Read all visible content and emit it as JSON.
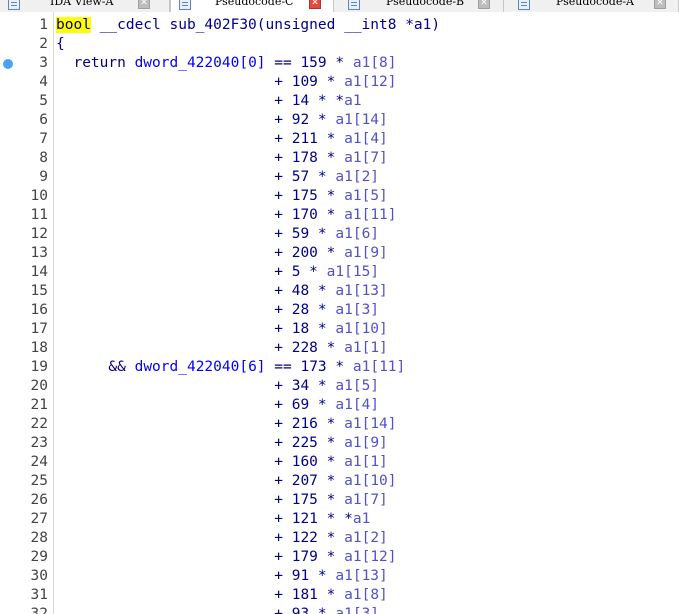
{
  "tabs": [
    {
      "label": "IDA View-A",
      "icon": "document-icon",
      "close_style": "grey",
      "active": false
    },
    {
      "label": "Pseudocode-C",
      "icon": "document-icon",
      "close_style": "red",
      "active": true
    },
    {
      "label": "Pseudocode-B",
      "icon": "document-icon",
      "close_style": "grey",
      "active": false
    },
    {
      "label": "Pseudocode-A",
      "icon": "document-icon",
      "close_style": "grey",
      "active": false
    }
  ],
  "close_glyph": "✕",
  "code": {
    "signature": {
      "ret_type": "bool",
      "rest": " __cdecl sub_402F30(unsigned __int8 *a1)"
    },
    "brace": "{",
    "return_kw": "return ",
    "and_op": "&& ",
    "eq": " == ",
    "plus": "+ ",
    "blocks": [
      {
        "dword": "dword_422040[0]",
        "terms": [
          {
            "c": "159",
            "a": "a1[8]"
          },
          {
            "c": "109",
            "a": "a1[12]"
          },
          {
            "c": "14",
            "a": "a1",
            "deref": true
          },
          {
            "c": "92",
            "a": "a1[14]"
          },
          {
            "c": "211",
            "a": "a1[4]"
          },
          {
            "c": "178",
            "a": "a1[7]"
          },
          {
            "c": "57",
            "a": "a1[2]"
          },
          {
            "c": "175",
            "a": "a1[5]"
          },
          {
            "c": "170",
            "a": "a1[11]"
          },
          {
            "c": "59",
            "a": "a1[6]"
          },
          {
            "c": "200",
            "a": "a1[9]"
          },
          {
            "c": "5",
            "a": "a1[15]"
          },
          {
            "c": "48",
            "a": "a1[13]"
          },
          {
            "c": "28",
            "a": "a1[3]"
          },
          {
            "c": "18",
            "a": "a1[10]"
          },
          {
            "c": "228",
            "a": "a1[1]"
          }
        ]
      },
      {
        "dword": "dword_422040[6]",
        "terms": [
          {
            "c": "173",
            "a": "a1[11]"
          },
          {
            "c": "34",
            "a": "a1[5]"
          },
          {
            "c": "69",
            "a": "a1[4]"
          },
          {
            "c": "216",
            "a": "a1[14]"
          },
          {
            "c": "225",
            "a": "a1[9]"
          },
          {
            "c": "160",
            "a": "a1[1]"
          },
          {
            "c": "207",
            "a": "a1[10]"
          },
          {
            "c": "175",
            "a": "a1[7]"
          },
          {
            "c": "121",
            "a": "a1",
            "deref": true
          },
          {
            "c": "122",
            "a": "a1[2]"
          },
          {
            "c": "179",
            "a": "a1[12]"
          },
          {
            "c": "91",
            "a": "a1[13]"
          },
          {
            "c": "181",
            "a": "a1[8]"
          },
          {
            "c": "93",
            "a": "a1[3]"
          }
        ]
      }
    ]
  },
  "breakpoint_line": 3,
  "colors": {
    "keyword_highlight": "#ffff00",
    "code_text": "#00008b",
    "global_var": "#0000ff",
    "argument": "#5151c8",
    "breakpoint": "#4aa3f0",
    "close_active": "#e24b3b"
  }
}
